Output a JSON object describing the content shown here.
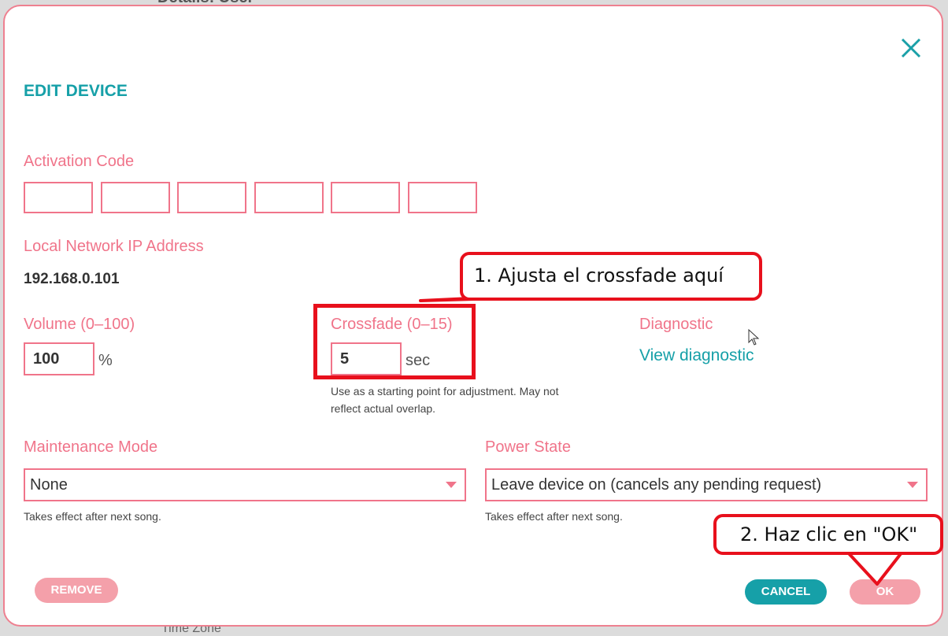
{
  "background": {
    "peek_top": "Details: User",
    "peek_bottom": "Time Zone"
  },
  "dialog": {
    "title": "EDIT DEVICE",
    "close_icon": "close-icon",
    "activation": {
      "label": "Activation Code",
      "boxes": [
        "",
        "",
        "",
        "",
        "",
        ""
      ]
    },
    "ip": {
      "label": "Local Network IP Address",
      "value": "192.168.0.101"
    },
    "volume": {
      "label": "Volume (0–100)",
      "value": "100",
      "unit": "%"
    },
    "crossfade": {
      "label": "Crossfade (0–15)",
      "value": "5",
      "unit": "sec",
      "hint_line1": "Use as a starting point for adjustment. May not",
      "hint_line2": "reflect actual overlap."
    },
    "diagnostic": {
      "label": "Diagnostic",
      "link": "View diagnostic"
    },
    "maintenance": {
      "label": "Maintenance Mode",
      "selected": "None",
      "hint": "Takes effect after next song."
    },
    "power": {
      "label": "Power State",
      "selected": "Leave device on (cancels any pending request)",
      "hint": "Takes effect after next song."
    },
    "buttons": {
      "remove": "REMOVE",
      "cancel": "CANCEL",
      "ok": "OK"
    }
  },
  "annotations": {
    "step1": "1. Ajusta el crossfade aquí",
    "step2": "2. Haz clic en \"OK\""
  },
  "colors": {
    "accent_teal": "#16a0a8",
    "label_pink": "#f0748a",
    "annotation_red": "#e8101c"
  }
}
